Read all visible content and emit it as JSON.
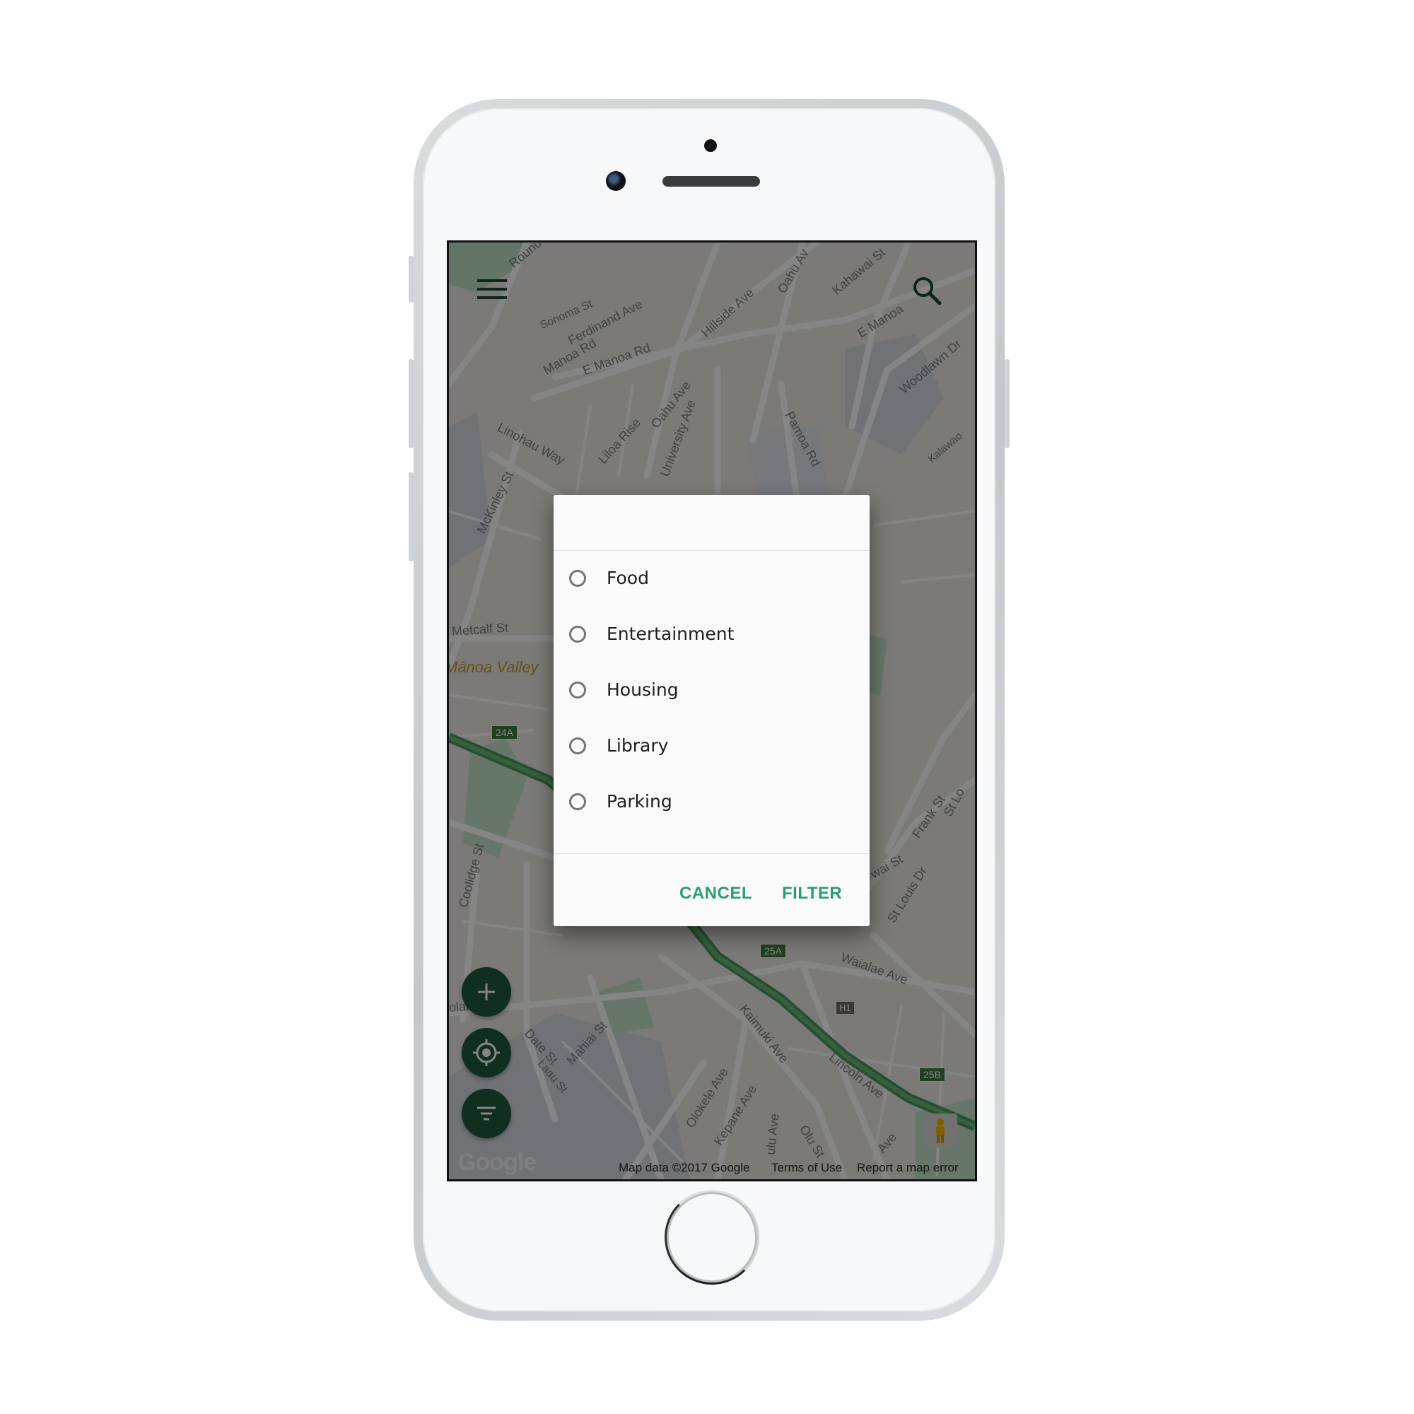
{
  "app": {
    "icons": {
      "menu": "menu-icon",
      "search": "search-icon",
      "add": "plus-icon",
      "locate": "crosshair-icon",
      "filter": "filter-icon",
      "street_view": "pegman-icon"
    },
    "accent_color": "#1f5a3e",
    "dialog_button_color": "#2a9e70"
  },
  "map": {
    "labels": {
      "rouno": "Rouno",
      "sonoma": "Sonoma St",
      "ferdinand": "Ferdinand Ave",
      "manoa_rd": "Manoa Rd",
      "e_manoa_rd": "E Manoa Rd",
      "hillside": "Hillside Ave",
      "oahu_top": "Oahu Av",
      "kahawai": "Kahawai St",
      "e_manoa": "E Manoa",
      "woodlawn": "Woodlawn Dr",
      "kalawao": "Kalawao",
      "linohau": "Linohau Way",
      "liloa": "Liloa Rise",
      "oahu_ave": "Oahu Ave",
      "university": "University Ave",
      "pamoa": "Pamoa Rd",
      "mckinley": "McKinley St",
      "metcalf": "Metcalf St",
      "manoa_valley": "Mānoa Valley",
      "shield_24a": "24A",
      "coolidge": "Coolidge St",
      "frank": "Frank St",
      "st_lo": "St Lo",
      "wai_st": "wai St",
      "st_louis": "St Louis Dr",
      "shield_25a": "25A",
      "waialae": "Waialae Ave",
      "olani_blvd": "olani Blvd",
      "date_st": "Date St",
      "mahiai": "Mahiai St",
      "laau": "Laau St",
      "kaimuki": "Kaimuki Ave",
      "shield_h1": "H1",
      "lincoln": "Lincoln Ave",
      "shield_25b": "25B",
      "olokele": "Olokele Ave",
      "kepane": "Kepane Ave",
      "ulu": "ulu Ave",
      "olu": "Olu St",
      "ave_br": "Ave"
    },
    "google_logo": "Google",
    "attribution": {
      "map_data": "Map data ©2017 Google",
      "terms": "Terms of Use",
      "report": "Report a map error"
    }
  },
  "dialog": {
    "title": "",
    "options": [
      {
        "label": "Food",
        "selected": false
      },
      {
        "label": "Entertainment",
        "selected": false
      },
      {
        "label": "Housing",
        "selected": false
      },
      {
        "label": "Library",
        "selected": false
      },
      {
        "label": "Parking",
        "selected": false
      }
    ],
    "cancel_label": "CANCEL",
    "filter_label": "FILTER"
  }
}
